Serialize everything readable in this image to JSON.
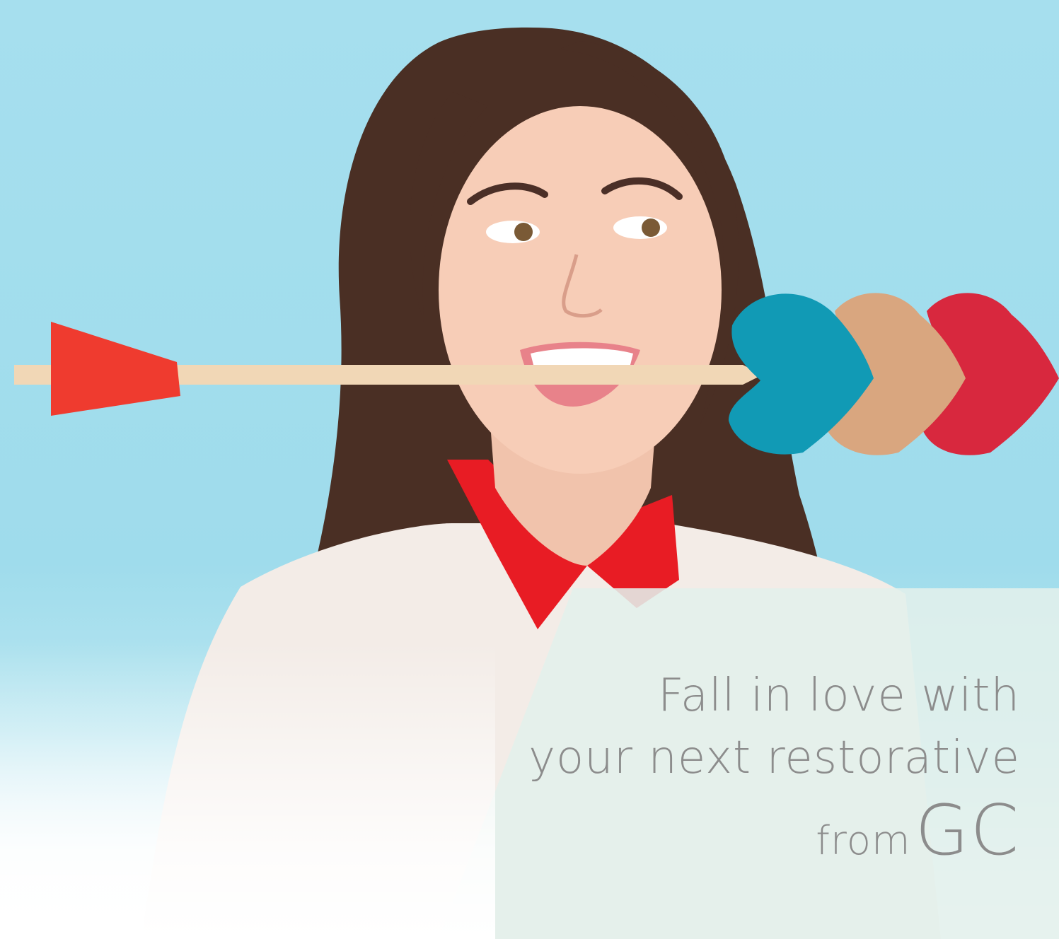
{
  "headline": {
    "line1": "Fall in love with",
    "line2": "your next restorative",
    "line3_prefix": "from",
    "line3_brand": "GC"
  },
  "colors": {
    "sky": "#a6dfee",
    "panel": "#e3f0ec",
    "text": "#8c8c8c",
    "arrow_tip": "#ef3b2f",
    "heart_teal": "#119ab5",
    "heart_tan": "#d9a67f",
    "heart_red": "#d8283e"
  }
}
